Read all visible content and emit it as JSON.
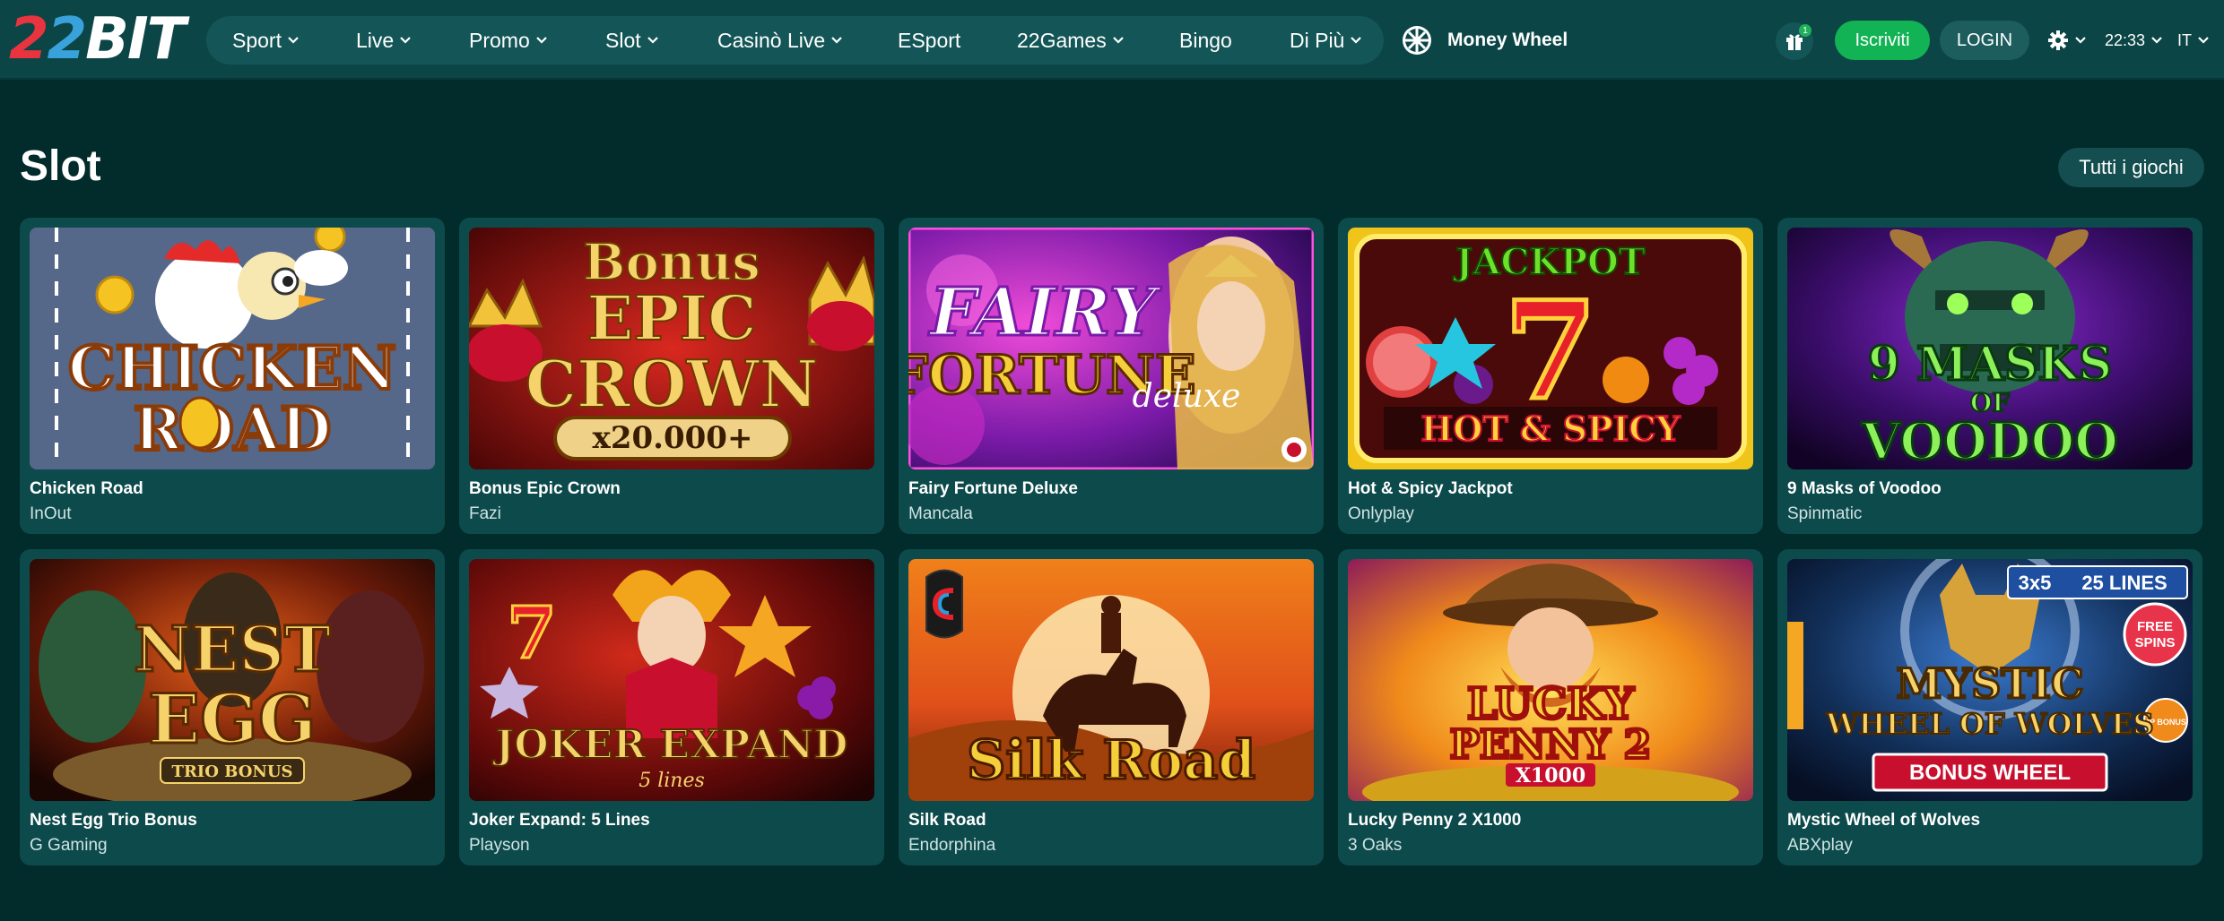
{
  "header": {
    "logo": {
      "part1": "2",
      "part2": "2",
      "part3": "BIT"
    },
    "nav": [
      {
        "label": "Sport",
        "dropdown": true
      },
      {
        "label": "Live",
        "dropdown": true
      },
      {
        "label": "Promo",
        "dropdown": true
      },
      {
        "label": "Slot",
        "dropdown": true
      },
      {
        "label": "Casinò Live",
        "dropdown": true
      },
      {
        "label": "ESport",
        "dropdown": false
      },
      {
        "label": "22Games",
        "dropdown": true
      },
      {
        "label": "Bingo",
        "dropdown": false
      },
      {
        "label": "Di Più",
        "dropdown": true
      }
    ],
    "money_wheel": "Money Wheel",
    "gift_count": "1",
    "register": "Iscriviti",
    "login": "LOGIN",
    "time": "22:33",
    "language": "IT"
  },
  "section": {
    "title": "Slot",
    "all_games": "Tutti i giochi"
  },
  "games": [
    {
      "title": "Chicken Road",
      "provider": "InOut",
      "art": {
        "line1": "CHICKEN",
        "line2": "ROAD"
      }
    },
    {
      "title": "Bonus Epic Crown",
      "provider": "Fazi",
      "art": {
        "line1": "Bonus",
        "line2": "EPIC",
        "line3": "CROWN",
        "line4": "x20.000+"
      }
    },
    {
      "title": "Fairy Fortune Deluxe",
      "provider": "Mancala",
      "art": {
        "line1": "FAIRY",
        "line2": "FORTUNE",
        "line3": "deluxe"
      }
    },
    {
      "title": "Hot & Spicy Jackpot",
      "provider": "Onlyplay",
      "art": {
        "line1": "JACKPOT",
        "line2": "HOT & SPICY"
      }
    },
    {
      "title": "9 Masks of Voodoo",
      "provider": "Spinmatic",
      "art": {
        "line1": "9 MASKS",
        "line2": "OF",
        "line3": "VOODOO"
      }
    },
    {
      "title": "Nest Egg Trio Bonus",
      "provider": "G Gaming",
      "art": {
        "line1": "NEST",
        "line2": "EGG",
        "line3": "TRIO BONUS"
      }
    },
    {
      "title": "Joker Expand: 5 Lines",
      "provider": "Playson",
      "art": {
        "line1": "JOKER EXPAND",
        "line2": "5 lines"
      }
    },
    {
      "title": "Silk Road",
      "provider": "Endorphina",
      "art": {
        "line1": "Silk Road"
      }
    },
    {
      "title": "Lucky Penny 2 X1000",
      "provider": "3 Oaks",
      "art": {
        "line1": "LUCKY",
        "line2": "PENNY 2",
        "line3": "X1000"
      }
    },
    {
      "title": "Mystic Wheel of Wolves",
      "provider": "ABXplay",
      "art": {
        "line1": "MYSTIC",
        "line2": "WHEEL OF WOLVES",
        "line3": "BONUS WHEEL",
        "badge_lines": "3x5",
        "badge_count": "25 LINES",
        "free": "FREE",
        "spins": "SPINS",
        "jp": "JP BONUS"
      }
    }
  ],
  "colors": {
    "background": "#022b2c",
    "header": "#0b4546",
    "card": "#0d4a4b",
    "register_green": "#12b354",
    "logo_red": "#e8343f",
    "logo_blue": "#3aa2db"
  }
}
